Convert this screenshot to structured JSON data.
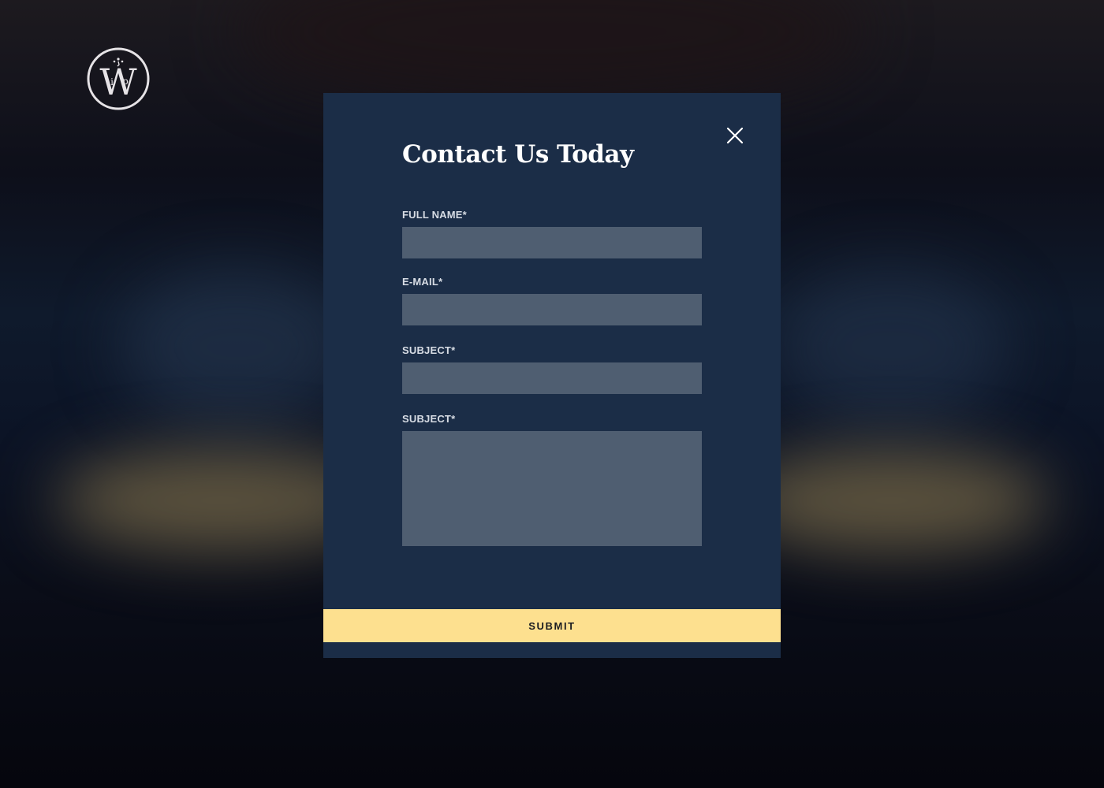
{
  "logo": {
    "icon": "wip-monogram-logo",
    "color": "#e6e3e6"
  },
  "modal": {
    "title": "Contact Us Today",
    "close_icon": "close-icon",
    "fields": [
      {
        "label": "FULL NAME*",
        "value": "",
        "placeholder": ""
      },
      {
        "label": "E-MAIL*",
        "value": "",
        "placeholder": ""
      },
      {
        "label": "SUBJECT*",
        "value": "",
        "placeholder": ""
      },
      {
        "label": "SUBJECT*",
        "value": "",
        "placeholder": ""
      }
    ],
    "submit_label": "SUBMIT"
  },
  "colors": {
    "modal_background": "#1b2d47",
    "input_background": "#4f5e71",
    "submit_background": "#fde08f",
    "label_text": "#d7dce4",
    "title_text": "#ffffff"
  }
}
